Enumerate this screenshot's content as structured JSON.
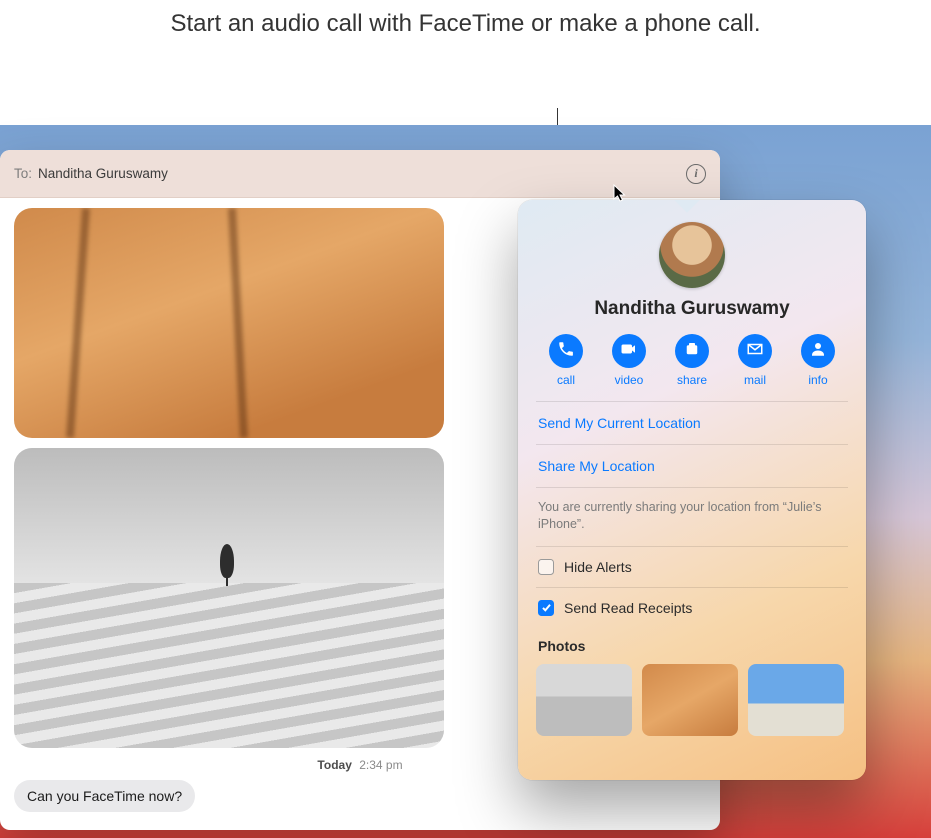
{
  "annotation": "Start an audio call with FaceTime or make a phone call.",
  "header": {
    "to_label": "To:",
    "recipient": "Nanditha Guruswamy",
    "info_glyph": "i"
  },
  "conversation": {
    "timestamp_day": "Today",
    "timestamp_time": "2:34 pm",
    "outgoing_bubble": "Can you FaceTime now?"
  },
  "popover": {
    "contact_name": "Nanditha Guruswamy",
    "actions": {
      "call": "call",
      "video": "video",
      "share": "share",
      "mail": "mail",
      "info": "info"
    },
    "links": {
      "send_current": "Send My Current Location",
      "share_location": "Share My Location"
    },
    "sharing_note": "You are currently sharing your location from “Julie’s iPhone”.",
    "hide_alerts": "Hide Alerts",
    "read_receipts": "Send Read Receipts",
    "photos_header": "Photos"
  }
}
